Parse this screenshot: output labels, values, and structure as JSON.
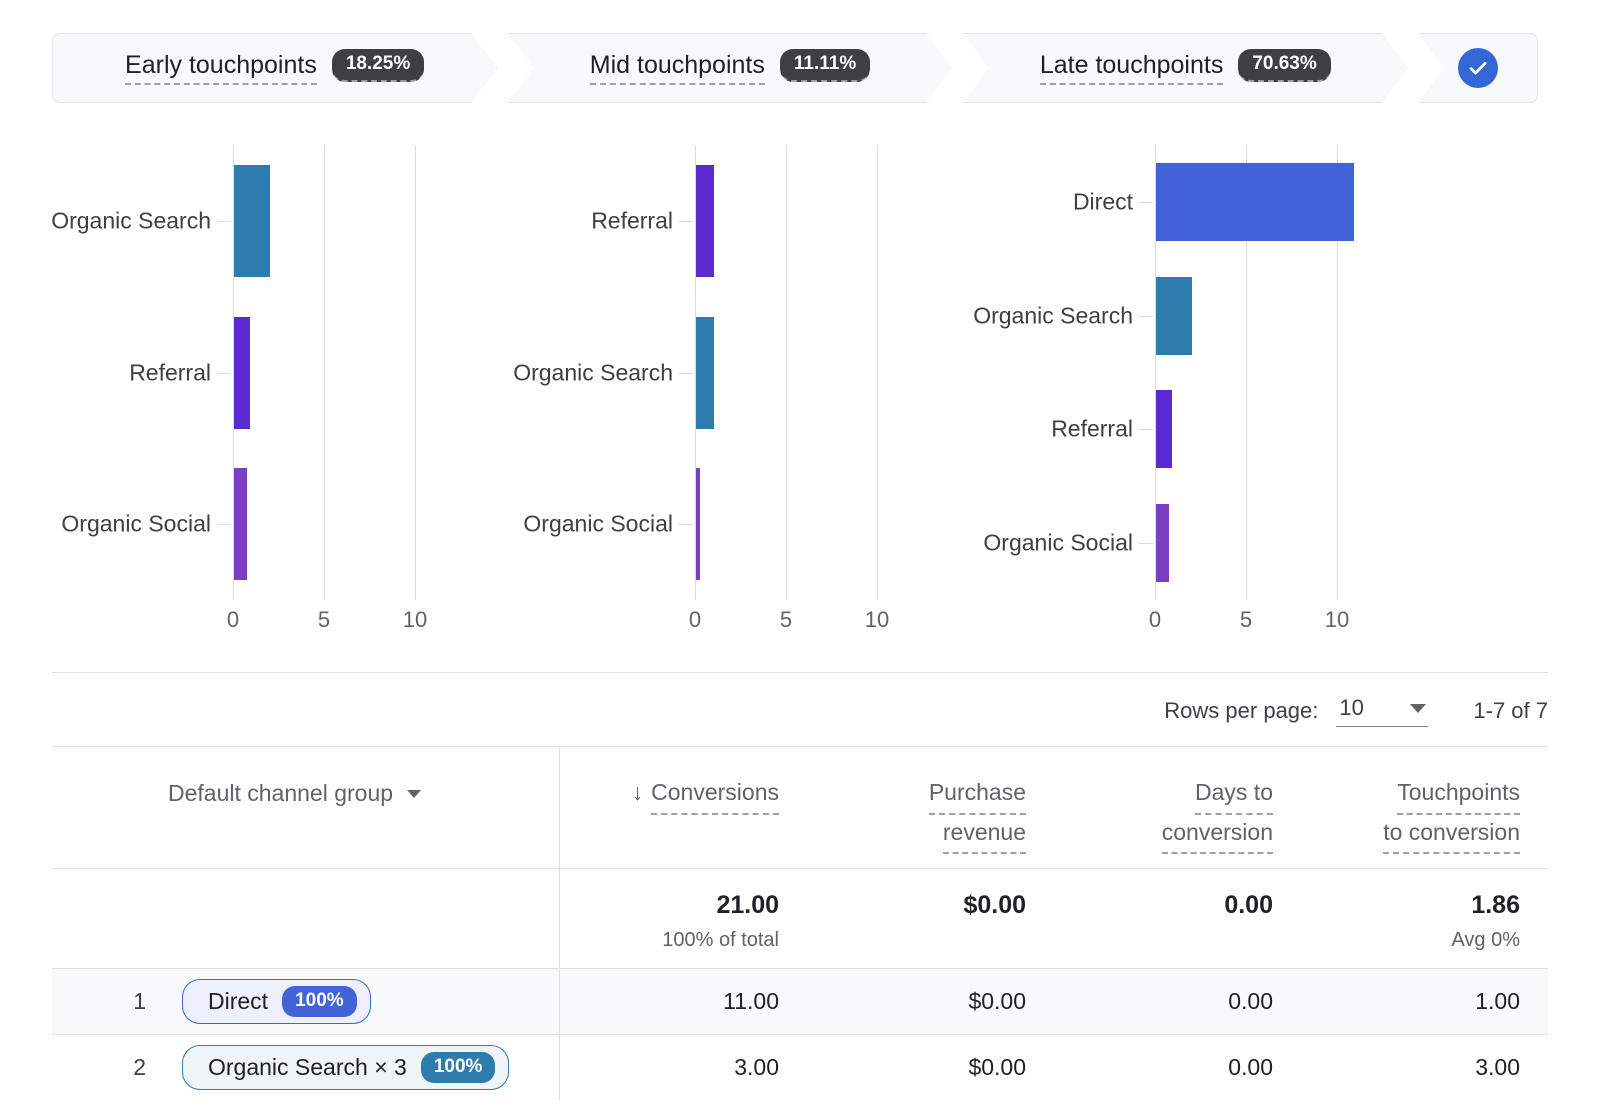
{
  "funnel": {
    "segments": [
      {
        "label": "Early touchpoints",
        "percent": "18.25%"
      },
      {
        "label": "Mid touchpoints",
        "percent": "11.11%"
      },
      {
        "label": "Late touchpoints",
        "percent": "70.63%"
      }
    ],
    "endcap_icon": "check-circle-icon"
  },
  "chart_data": [
    {
      "type": "bar",
      "title": "Early touchpoints",
      "orientation": "horizontal",
      "categories": [
        "Organic Search",
        "Referral",
        "Organic Social"
      ],
      "values": [
        2,
        0.9,
        0.7
      ],
      "colors": [
        "#2e7cad",
        "#5a2bd0",
        "#7b3fc4"
      ],
      "xlabel": "",
      "ylabel": "",
      "xlim": [
        0,
        12.2
      ],
      "xticks": [
        "0",
        "5",
        "10"
      ],
      "grid": true,
      "legend": "none"
    },
    {
      "type": "bar",
      "title": "Mid touchpoints",
      "orientation": "horizontal",
      "categories": [
        "Referral",
        "Organic Search",
        "Organic Social"
      ],
      "values": [
        1,
        1,
        0.22
      ],
      "colors": [
        "#5a2bd0",
        "#2e7cad",
        "#7b3fc4"
      ],
      "xlabel": "",
      "ylabel": "",
      "xlim": [
        0,
        12.2
      ],
      "xticks": [
        "0",
        "5",
        "10"
      ],
      "grid": true,
      "legend": "none"
    },
    {
      "type": "bar",
      "title": "Late touchpoints",
      "orientation": "horizontal",
      "categories": [
        "Direct",
        "Organic Search",
        "Referral",
        "Organic Social"
      ],
      "values": [
        10.9,
        2,
        0.9,
        0.7
      ],
      "colors": [
        "#4263d8",
        "#2e7cad",
        "#5a2bd0",
        "#7b3fc4"
      ],
      "xlabel": "",
      "ylabel": "",
      "xlim": [
        0,
        12.2
      ],
      "xticks": [
        "0",
        "5",
        "10"
      ],
      "grid": true,
      "legend": "none"
    }
  ],
  "pagination": {
    "rows_per_page_label": "Rows per page:",
    "rows_per_page_value": "10",
    "caret_icon": "chevron-down-icon",
    "range": "1-7 of 7"
  },
  "table": {
    "dimension_label": "Default channel group",
    "dimension_caret_icon": "chevron-down-icon",
    "sort_arrow": "↓",
    "columns": [
      {
        "line1": "Conversions",
        "line2": "",
        "sorted": true
      },
      {
        "line1": "Purchase",
        "line2": "revenue",
        "sorted": false
      },
      {
        "line1": "Days to",
        "line2": "conversion",
        "sorted": false
      },
      {
        "line1": "Touchpoints",
        "line2": "to conversion",
        "sorted": false
      }
    ],
    "totals": {
      "conversions": "21.00",
      "conversions_sub": "100% of total",
      "purchase_revenue": "$0.00",
      "purchase_revenue_sub": "",
      "days_to_conversion": "0.00",
      "days_to_conversion_sub": "",
      "touchpoints_to_conversion": "1.86",
      "touchpoints_to_conversion_sub": "Avg 0%"
    },
    "rows": [
      {
        "rank": "1",
        "chip_label": "Direct",
        "chip_percent": "100%",
        "chip_border": "#4263d8",
        "chip_bg": "#eef0fd",
        "badge_bg": "#4263d8",
        "conversions": "11.00",
        "purchase_revenue": "$0.00",
        "days_to_conversion": "0.00",
        "touchpoints_to_conversion": "1.00"
      },
      {
        "rank": "2",
        "chip_label": "Organic Search × 3",
        "chip_percent": "100%",
        "chip_border": "#2e7cad",
        "chip_bg": "#eef4f8",
        "badge_bg": "#2e7cad",
        "conversions": "3.00",
        "purchase_revenue": "$0.00",
        "days_to_conversion": "0.00",
        "touchpoints_to_conversion": "3.00"
      }
    ]
  }
}
